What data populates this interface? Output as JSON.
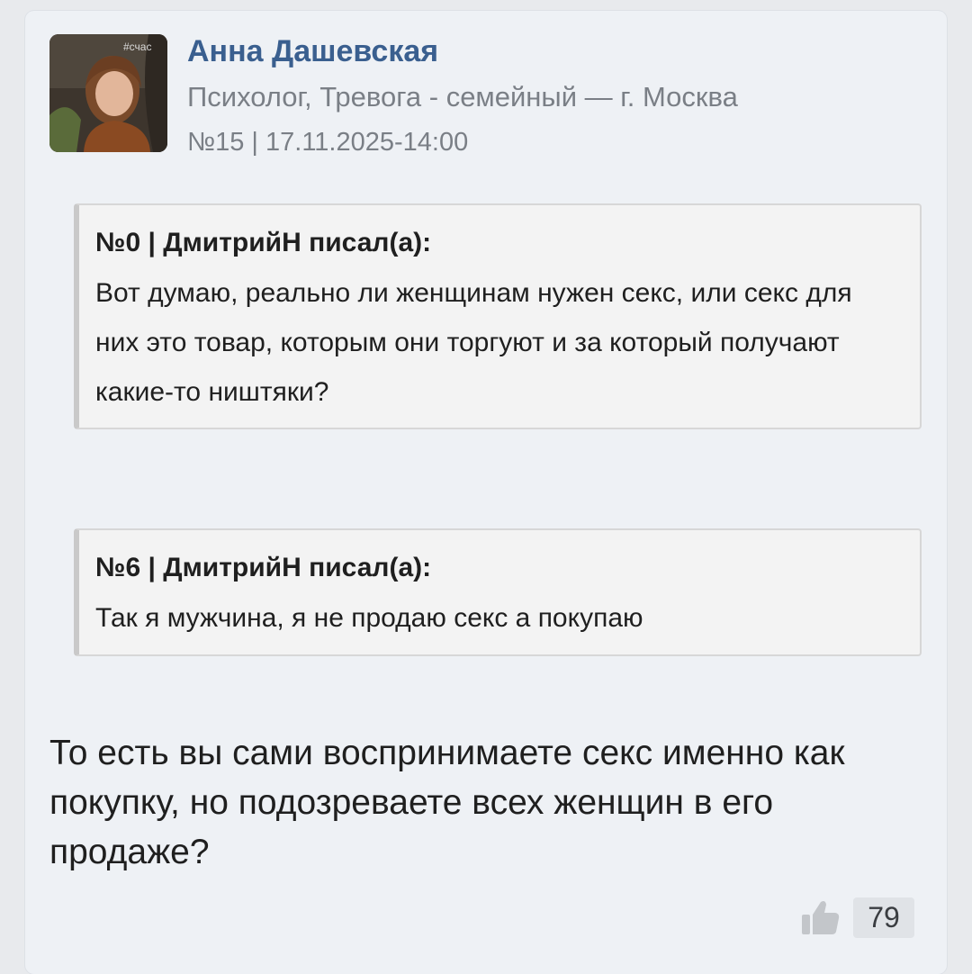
{
  "post": {
    "author": {
      "name": "Анна Дашевская",
      "meta": "Психолог, Тревога - семейный — г. Москва",
      "avatar_caption": "#счас"
    },
    "info": "№15 | 17.11.2025-14:00",
    "quotes": [
      {
        "header": "№0 | ДмитрийН писал(а):",
        "text": "Вот думаю, реально ли женщинам нужен секс, или секс для них это товар, которым они торгуют и за который получают какие-то ништяки?"
      },
      {
        "header": "№6 | ДмитрийН писал(а):",
        "text": "Так я мужчина, я не продаю секс а покупаю"
      }
    ],
    "reply": "То есть вы сами воспринимаете секс именно как покупку, но подозреваете всех женщин в его продаже?",
    "likes": {
      "icon": "thumbs-up-icon",
      "count": "79"
    }
  }
}
